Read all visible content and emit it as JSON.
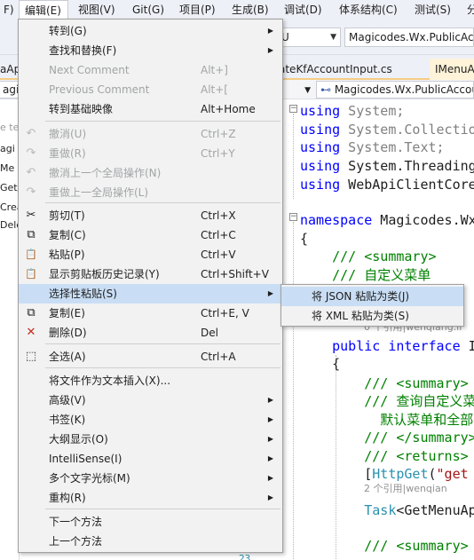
{
  "menubar": {
    "items": [
      {
        "label": "F)"
      },
      {
        "label": "编辑(E)"
      },
      {
        "label": "视图(V)"
      },
      {
        "label": "Git(G)"
      },
      {
        "label": "项目(P)"
      },
      {
        "label": "生成(B)"
      },
      {
        "label": "调试(D)"
      },
      {
        "label": "体系结构(C)"
      },
      {
        "label": "测试(S)"
      },
      {
        "label": "分"
      }
    ]
  },
  "toolbar": {
    "config_value": "U",
    "project_value": "Magicodes.Wx.PublicAcc"
  },
  "tabs": [
    {
      "label": "aAp"
    },
    {
      "label": "ateKfAccountInput.cs"
    },
    {
      "label": "IMenuA"
    }
  ],
  "navbar": {
    "left_value": "agico",
    "member_value": "Magicodes.Wx.PublicAccou"
  },
  "left_panel": {
    "items": [
      "e tex",
      "agi",
      "Me",
      "Get/",
      "Crea",
      "Dele"
    ]
  },
  "edit_menu": {
    "items": [
      {
        "label": "转到(G)",
        "shortcut": "",
        "submenu": true,
        "icon": "",
        "disabled": false
      },
      {
        "label": "查找和替换(F)",
        "shortcut": "",
        "submenu": true,
        "icon": "",
        "disabled": false
      },
      {
        "label": "Next Comment",
        "shortcut": "Alt+]",
        "submenu": false,
        "icon": "",
        "disabled": true
      },
      {
        "label": "Previous Comment",
        "shortcut": "Alt+[",
        "submenu": false,
        "icon": "",
        "disabled": true
      },
      {
        "label": "转到基础映像",
        "shortcut": "Alt+Home",
        "submenu": false,
        "icon": "",
        "disabled": false
      },
      {
        "label": "撤消(U)",
        "shortcut": "Ctrl+Z",
        "submenu": false,
        "icon": "undo-icon",
        "disabled": true
      },
      {
        "label": "重做(R)",
        "shortcut": "Ctrl+Y",
        "submenu": false,
        "icon": "redo-icon",
        "disabled": true
      },
      {
        "label": "撤消上一个全局操作(N)",
        "shortcut": "",
        "submenu": false,
        "icon": "global-undo-icon",
        "disabled": true
      },
      {
        "label": "重做上一全局操作(L)",
        "shortcut": "",
        "submenu": false,
        "icon": "global-redo-icon",
        "disabled": true
      },
      {
        "label": "剪切(T)",
        "shortcut": "Ctrl+X",
        "submenu": false,
        "icon": "cut-icon",
        "disabled": false
      },
      {
        "label": "复制(C)",
        "shortcut": "Ctrl+C",
        "submenu": false,
        "icon": "copy-icon",
        "disabled": false
      },
      {
        "label": "粘贴(P)",
        "shortcut": "Ctrl+V",
        "submenu": false,
        "icon": "paste-icon",
        "disabled": false
      },
      {
        "label": "显示剪贴板历史记录(Y)",
        "shortcut": "Ctrl+Shift+V",
        "submenu": false,
        "icon": "clipboard-history-icon",
        "disabled": false
      },
      {
        "label": "选择性粘贴(S)",
        "shortcut": "",
        "submenu": true,
        "icon": "",
        "disabled": false
      },
      {
        "label": "复制(E)",
        "shortcut": "Ctrl+E, V",
        "submenu": false,
        "icon": "duplicate-icon",
        "disabled": false
      },
      {
        "label": "删除(D)",
        "shortcut": "Del",
        "submenu": false,
        "icon": "delete-icon",
        "disabled": false
      },
      {
        "label": "全选(A)",
        "shortcut": "Ctrl+A",
        "submenu": false,
        "icon": "select-all-icon",
        "disabled": false
      },
      {
        "label": "将文件作为文本插入(X)...",
        "shortcut": "",
        "submenu": false,
        "icon": "",
        "disabled": false
      },
      {
        "label": "高级(V)",
        "shortcut": "",
        "submenu": true,
        "icon": "",
        "disabled": false
      },
      {
        "label": "书签(K)",
        "shortcut": "",
        "submenu": true,
        "icon": "",
        "disabled": false
      },
      {
        "label": "大纲显示(O)",
        "shortcut": "",
        "submenu": true,
        "icon": "",
        "disabled": false
      },
      {
        "label": "IntelliSense(I)",
        "shortcut": "",
        "submenu": true,
        "icon": "",
        "disabled": false
      },
      {
        "label": "多个文字光标(M)",
        "shortcut": "",
        "submenu": true,
        "icon": "",
        "disabled": false
      },
      {
        "label": "重构(R)",
        "shortcut": "",
        "submenu": true,
        "icon": "",
        "disabled": false
      },
      {
        "label": "下一个方法",
        "shortcut": "",
        "submenu": false,
        "icon": "",
        "disabled": false
      },
      {
        "label": "上一个方法",
        "shortcut": "",
        "submenu": false,
        "icon": "",
        "disabled": false
      }
    ]
  },
  "paste_special_menu": {
    "items": [
      {
        "label": "将 JSON 粘贴为类(J)"
      },
      {
        "label": "将 XML 粘贴为类(S)"
      }
    ]
  },
  "code": {
    "lines": [
      {
        "tokens": [
          [
            "using",
            "kw"
          ],
          [
            " System;",
            "gy"
          ]
        ]
      },
      {
        "tokens": [
          [
            "using",
            "kw"
          ],
          [
            " System.Collectio",
            "gy"
          ]
        ]
      },
      {
        "tokens": [
          [
            "using",
            "kw"
          ],
          [
            " System.Text;",
            "gy"
          ]
        ]
      },
      {
        "tokens": [
          [
            "using",
            "kw"
          ],
          [
            " System.Threading",
            ""
          ]
        ]
      },
      {
        "tokens": [
          [
            "using",
            "kw"
          ],
          [
            " WebApiClientCore",
            ""
          ]
        ]
      },
      {
        "tokens": [
          [
            "",
            ""
          ]
        ]
      },
      {
        "tokens": [
          [
            "namespace",
            "kw"
          ],
          [
            " Magicodes.Wx",
            ""
          ]
        ]
      },
      {
        "tokens": [
          [
            "{",
            ""
          ]
        ]
      },
      {
        "tokens": [
          [
            "    /// <summary>",
            "cm"
          ]
        ]
      },
      {
        "tokens": [
          [
            "    /// 自定义菜单",
            "cm"
          ]
        ]
      },
      {
        "tokens": [
          [
            "",
            ""
          ]
        ]
      },
      {
        "tokens": [
          [
            "",
            ""
          ]
        ]
      },
      {
        "tokens": [
          [
            "    ",
            ""
          ],
          [
            "public",
            "kw"
          ],
          [
            " ",
            ""
          ],
          [
            "interface",
            "kw"
          ],
          [
            " I",
            ""
          ]
        ]
      },
      {
        "tokens": [
          [
            "    {",
            ""
          ]
        ]
      },
      {
        "tokens": [
          [
            "",
            ""
          ]
        ]
      },
      {
        "tokens": [
          [
            "        /// <summary>",
            "cm"
          ]
        ]
      },
      {
        "tokens": [
          [
            "        /// 查询自定义菜",
            "cm"
          ]
        ]
      },
      {
        "tokens": [
          [
            "          默认菜单和全部",
            "cm"
          ]
        ]
      },
      {
        "tokens": [
          [
            "        /// </summary>",
            "cm"
          ]
        ]
      },
      {
        "tokens": [
          [
            "        /// <returns>",
            "cm"
          ]
        ]
      },
      {
        "tokens": [
          [
            "        [",
            ""
          ],
          [
            "HttpGet",
            "ty"
          ],
          [
            "(",
            ""
          ],
          [
            "\"get",
            "st"
          ]
        ]
      },
      {
        "tokens": [
          [
            "",
            ""
          ]
        ]
      },
      {
        "tokens": [
          [
            "        ",
            ""
          ],
          [
            "Task",
            "ty"
          ],
          [
            "<GetMenuAp",
            ""
          ]
        ]
      },
      {
        "tokens": [
          [
            "",
            ""
          ]
        ]
      },
      {
        "tokens": [
          [
            "        /// <summary>",
            "cm"
          ]
        ]
      }
    ],
    "hint1": "0 个引用|wenqiang.li",
    "hint2": "2 个引用|wenqian",
    "bottom_line_number": "23"
  }
}
